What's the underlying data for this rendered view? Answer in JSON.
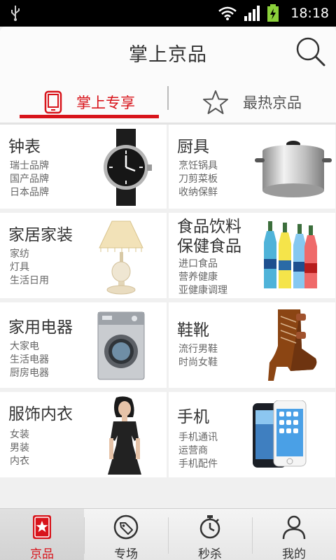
{
  "status_bar": {
    "time": "18:18"
  },
  "header": {
    "title": "掌上京品"
  },
  "tabs": [
    {
      "label": "掌上专享",
      "active": true
    },
    {
      "label": "最热京品",
      "active": false
    }
  ],
  "categories": [
    {
      "title": "钟表",
      "subs": [
        "瑞士品牌",
        "国产品牌",
        "日本品牌"
      ]
    },
    {
      "title": "厨具",
      "subs": [
        "烹饪锅具",
        "刀剪菜板",
        "收纳保鲜"
      ]
    },
    {
      "title": "家居家装",
      "subs": [
        "家纺",
        "灯具",
        "生活日用"
      ]
    },
    {
      "title_lines": [
        "食品饮料",
        "保健食品"
      ],
      "subs": [
        "进口食品",
        "营养健康",
        "亚健康调理"
      ]
    },
    {
      "title": "家用电器",
      "subs": [
        "大家电",
        "生活电器",
        "厨房电器"
      ]
    },
    {
      "title": "鞋靴",
      "subs": [
        "流行男鞋",
        "时尚女鞋"
      ]
    },
    {
      "title": "服饰内衣",
      "subs": [
        "女装",
        "男装",
        "内衣"
      ]
    },
    {
      "title": "手机",
      "subs": [
        "手机通讯",
        "运营商",
        "手机配件"
      ]
    }
  ],
  "bottom_nav": [
    {
      "label": "京品",
      "icon": "star-card-icon",
      "active": true
    },
    {
      "label": "专场",
      "icon": "tag-icon",
      "active": false
    },
    {
      "label": "秒杀",
      "icon": "stopwatch-icon",
      "active": false
    },
    {
      "label": "我的",
      "icon": "person-icon",
      "active": false
    }
  ],
  "colors": {
    "accent": "#d8141b",
    "background": "#f0f0f0",
    "status_bar": "#000000"
  }
}
